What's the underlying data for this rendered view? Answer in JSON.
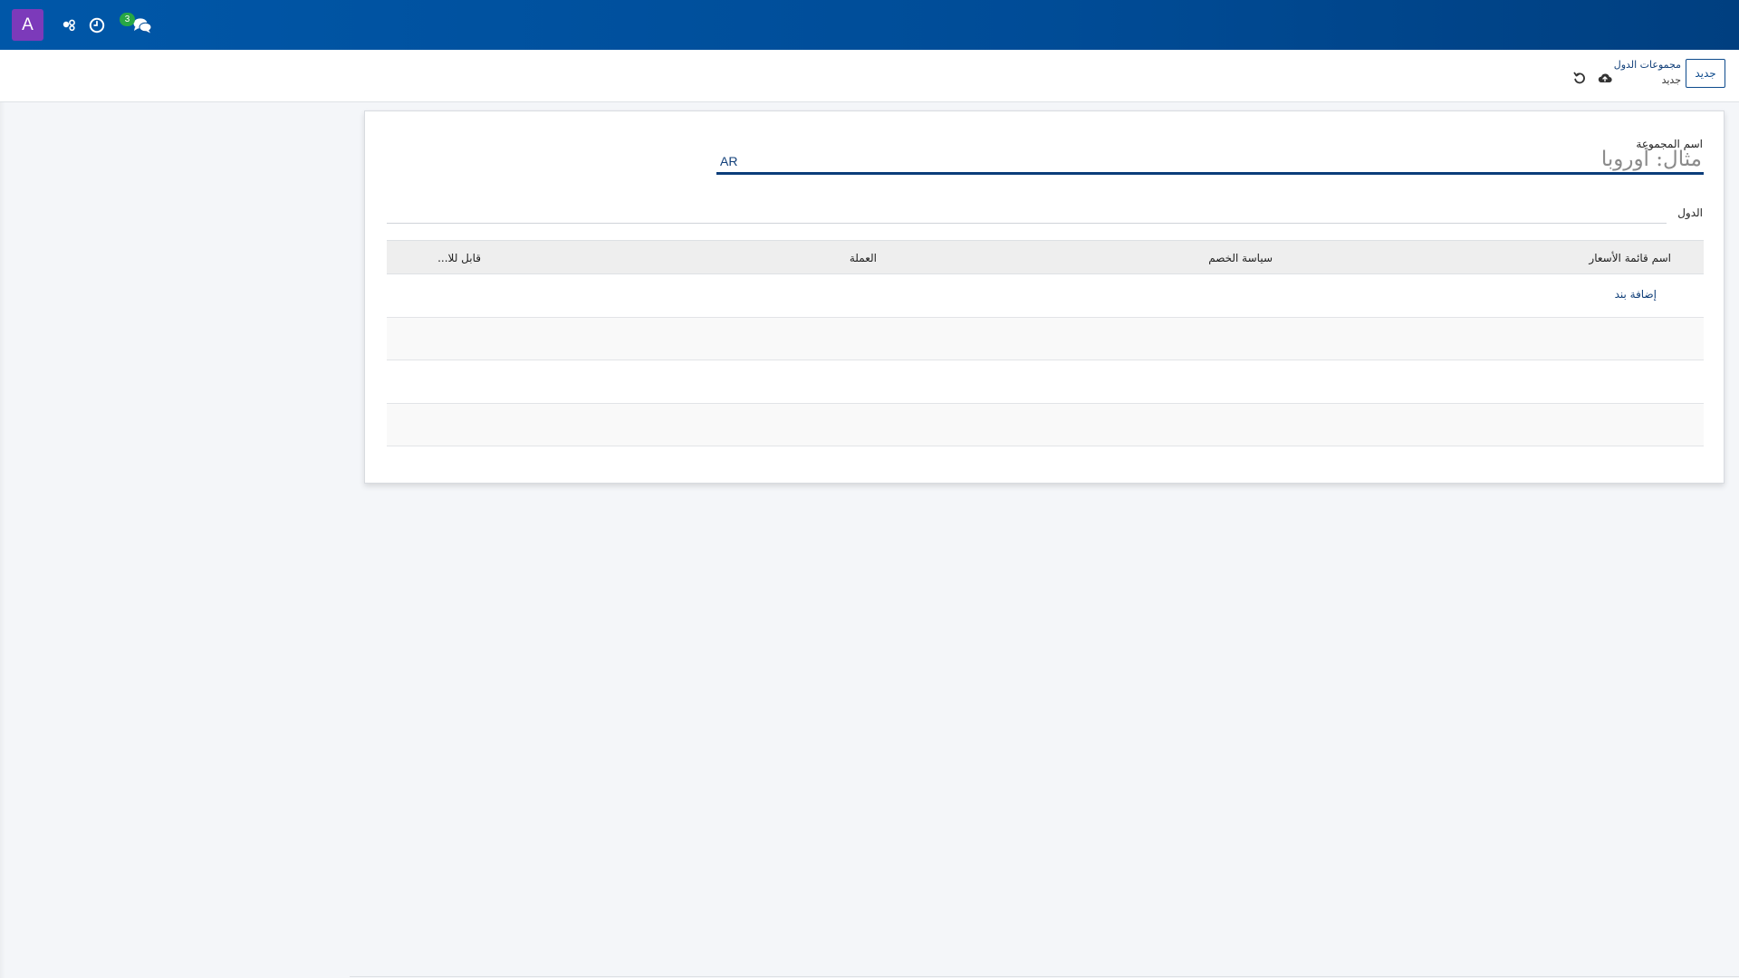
{
  "navbar": {
    "avatar_letter": "A",
    "icons": [
      "users-cog-icon",
      "clock-icon",
      "comments-icon"
    ],
    "messages_badge": "3"
  },
  "control_panel": {
    "new_button": "جديد",
    "breadcrumb": {
      "parent": "مجموعات الدول",
      "current": "جديد"
    },
    "icons": [
      "cloud-upload-icon",
      "undo-icon"
    ]
  },
  "form": {
    "group_name_label": "اسم المجموعة",
    "group_name_placeholder": "مثال: أوروبا",
    "group_name_value": "",
    "lang_tag": "AR",
    "countries_label": "الدول",
    "table": {
      "columns": [
        "اسم قائمة الأسعار",
        "سياسة الخصم",
        "العملة",
        "قابل للا..."
      ],
      "add_line": "إضافة بند",
      "empty_rows": 3
    }
  },
  "colors": {
    "navbar": "#0057a8",
    "avatar": "#7c3aba",
    "badge": "#28a745",
    "primary_text": "#12407a"
  }
}
